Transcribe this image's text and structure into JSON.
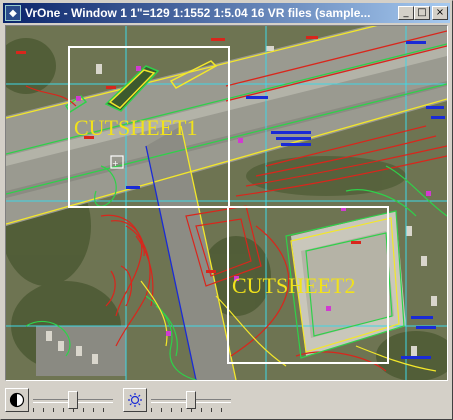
{
  "window": {
    "title": "VrOne - Window 1   1\"=129   1:1552   1:5.04   16 VR files (sample...",
    "buttons": {
      "minimize": "_",
      "maximize": "□",
      "close": "×"
    }
  },
  "map": {
    "sheets": [
      {
        "label": "CUTSHEET1"
      },
      {
        "label": "CUTSHEET2"
      }
    ],
    "colors": {
      "sheet_frame": "#ffffff",
      "sheet_label": "#f1e21b",
      "contour_red": "#d9261c",
      "contour_green": "#2fd14a",
      "contour_yellow": "#f3e72a",
      "grid_cyan": "#3fd7e6",
      "annotation_blue": "#1a2bd6",
      "annotation_magenta": "#d13bd1"
    }
  },
  "toolbar": {
    "contrast_icon": "contrast-icon",
    "brightness_icon": "brightness-icon",
    "contrast_level": 0.5,
    "brightness_level": 0.5
  }
}
